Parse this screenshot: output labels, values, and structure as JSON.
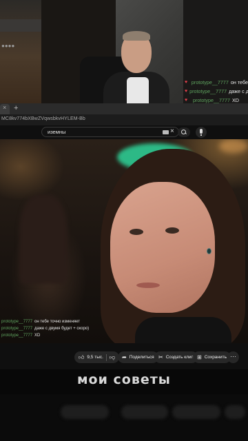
{
  "cam": {
    "chat": [
      {
        "user": "prototype__7777",
        "msg": "он тебе"
      },
      {
        "user": "prototype__7777",
        "msg": "даже с д"
      },
      {
        "user": "prototype__7777",
        "msg": "XD"
      }
    ]
  },
  "browser": {
    "tab_close": "×",
    "tab_plus": "+",
    "url": "MC8kv774bXBwZVqwsbkvHYLEM-Bb",
    "search_value": "иземны"
  },
  "video": {
    "chat": [
      {
        "user": "prototype__7777",
        "msg": "он тебе точно изменяет"
      },
      {
        "user": "prototype__7777",
        "msg": "даже с двумя будет + скоро)"
      },
      {
        "user": "prototype__7777",
        "msg": "XD"
      }
    ]
  },
  "actions": {
    "likes": "9,5 тыс.",
    "share": "Поделиться",
    "clip": "Создать клип",
    "save": "Сохранить",
    "more": "···"
  },
  "caption": "мои советы",
  "colors": {
    "username": "#5fa35f",
    "heart": "#e0404a",
    "pill": "#272727"
  },
  "icons": [
    "heart-icon",
    "like-icon",
    "dislike-icon",
    "share-icon",
    "clip-icon",
    "save-icon",
    "search-icon",
    "mic-icon",
    "keyboard-icon",
    "close-icon"
  ]
}
